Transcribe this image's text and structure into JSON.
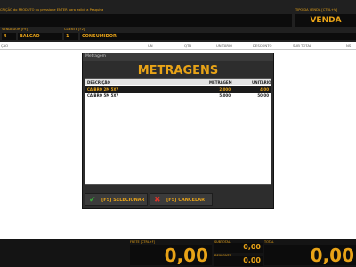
{
  "header": {
    "product_hint": "CRIÇÃO do PRODUTO ou pressione ENTER para exibir a Pesquisa",
    "sale_type_label": "TIPO DA VENDA [CTRL+V]",
    "sale_type_value": "VENDA"
  },
  "seller": {
    "label": "VENDEDOR [F9]",
    "code": "4",
    "name": "BALCAO"
  },
  "client": {
    "label": "CLIENTE [F2]",
    "code": "1",
    "name": "CONSUMIDOR"
  },
  "grid": {
    "columns": [
      "ÇÃO",
      "UN",
      "QTD",
      "UNITÁRIO",
      "DESCONTO",
      "SUB TOTAL",
      "NS"
    ]
  },
  "dialog": {
    "window_title": "Metragem",
    "heading": "METRAGENS",
    "columns": {
      "description": "DESCRIÇÃO",
      "meter": "METRAGEM",
      "unit": "UNITÁRIO"
    },
    "rows": [
      {
        "description": "CAIBRO 2M 5X7",
        "meter": "2,000",
        "unit": "4,00"
      },
      {
        "description": "CAIBRO 5M 5X7",
        "meter": "5,000",
        "unit": "50,00"
      }
    ],
    "select_label": "[F5] SELECIONAR",
    "cancel_label": "[F5] CANCELAR",
    "colors": {
      "accent": "#e8a317",
      "select_icon": "#3aa63a",
      "cancel_icon": "#d9342b"
    },
    "icons": {
      "select": "check-icon",
      "cancel": "x-icon"
    }
  },
  "footer": {
    "freight_label": "FRETE [CTRL+F]",
    "freight_value": "0,00",
    "subtotal_label": "SUBTOTAL",
    "subtotal_value": "0,00",
    "discount_label": "DESCONTO",
    "discount_value": "0,00",
    "total_label": "TOTAL",
    "total_value": "0,00"
  }
}
